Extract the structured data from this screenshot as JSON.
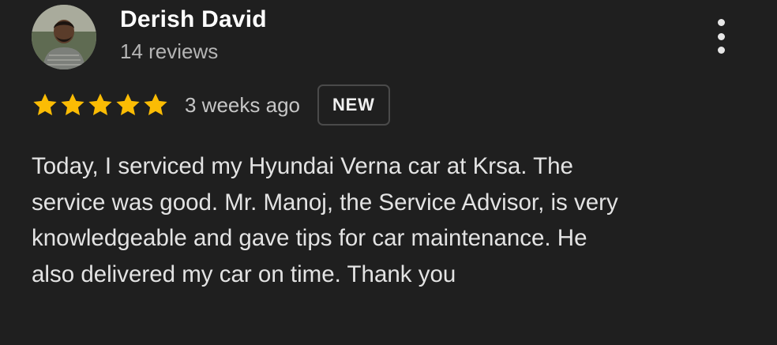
{
  "review": {
    "author_name": "Derish David",
    "author_reviews": "14 reviews",
    "rating": 5,
    "rating_max": 5,
    "time_ago": "3 weeks ago",
    "badge": "NEW",
    "text": "Today, I serviced my Hyundai Verna car at Krsa. The\nservice was good. Mr. Manoj, the Service Advisor, is very\nknowledgeable and gave tips for car maintenance. He\nalso delivered my car on time. Thank you"
  },
  "icons": {
    "menu": "more-vert-icon",
    "star": "star-icon"
  },
  "colors": {
    "background": "#1f1f1f",
    "star": "#fbbc04",
    "text": "#e3e3e3",
    "muted": "#b5b5b5",
    "badge_border": "#4a4a4a"
  }
}
